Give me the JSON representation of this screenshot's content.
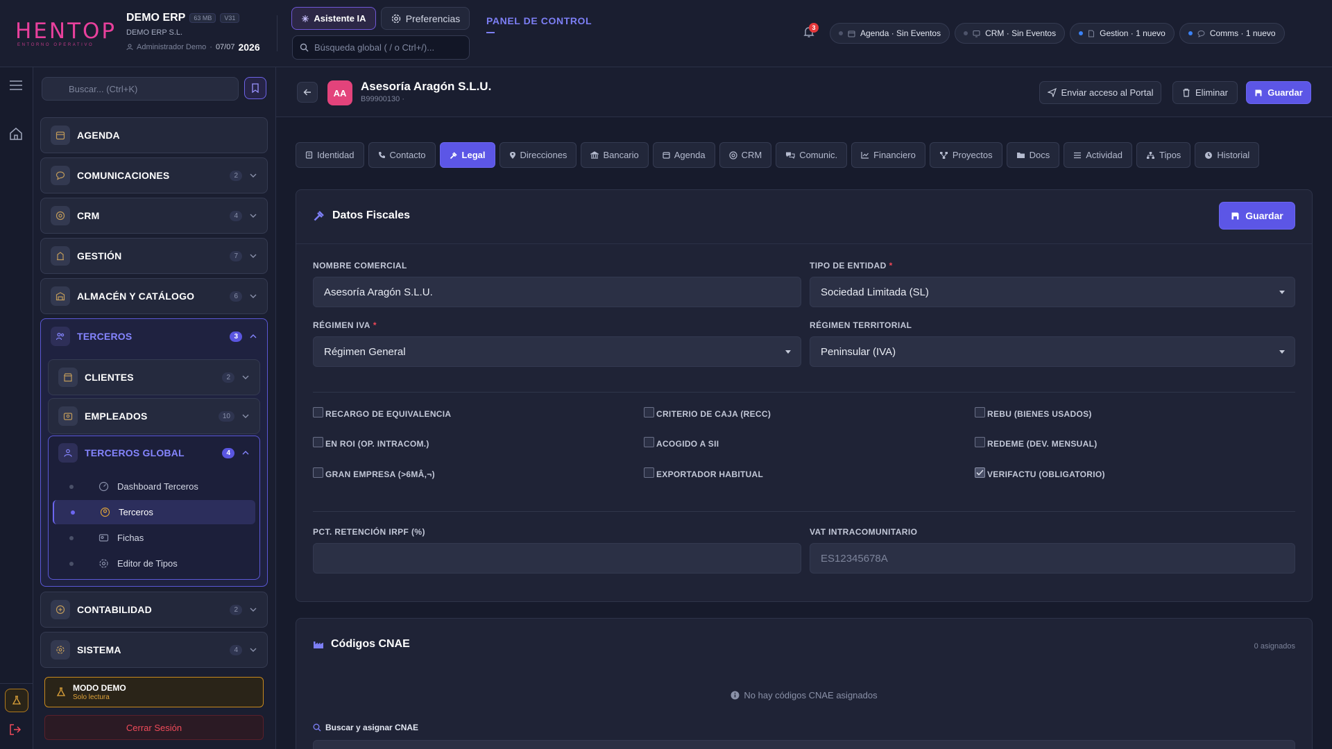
{
  "topbar": {
    "logo_text": "HENTOP",
    "logo_sub": "ENTORNO OPERATIVO",
    "company_name": "DEMO ERP",
    "size_chip": "63 MB",
    "version_chip": "V31",
    "company_sub": "DEMO ERP S.L.",
    "user": "Administrador Demo",
    "date": "07/07",
    "year": "2026",
    "ai_button": "Asistente IA",
    "prefs_button": "Preferencias",
    "search_placeholder": "Búsqueda global ( / o Ctrl+/)...",
    "panel_link": "PANEL DE CONTROL",
    "notif_count": "3",
    "pills": [
      {
        "label": "Agenda · Sin Eventos",
        "dot": "#4d536a"
      },
      {
        "label": "CRM · Sin Eventos",
        "dot": "#4d536a"
      },
      {
        "label": "Gestion · 1 nuevo",
        "dot": "#3b82f6"
      },
      {
        "label": "Comms · 1 nuevo",
        "dot": "#3b82f6"
      }
    ]
  },
  "sidebar": {
    "search_placeholder": "Buscar... (Ctrl+K)",
    "items": [
      {
        "label": "AGENDA",
        "count": ""
      },
      {
        "label": "COMUNICACIONES",
        "count": "2"
      },
      {
        "label": "CRM",
        "count": "4"
      },
      {
        "label": "GESTIÓN",
        "count": "7"
      },
      {
        "label": "ALMACÉN Y CATÁLOGO",
        "count": "6"
      }
    ],
    "group": {
      "label": "TERCEROS",
      "count": "3",
      "sub_items": [
        {
          "label": "CLIENTES",
          "count": "2"
        },
        {
          "label": "EMPLEADOS",
          "count": "10"
        }
      ],
      "subgroup": {
        "label": "TERCEROS GLOBAL",
        "count": "4",
        "leaves": [
          "Dashboard Terceros",
          "Terceros",
          "Fichas",
          "Editor de Tipos"
        ]
      }
    },
    "bottom_items": [
      {
        "label": "CONTABILIDAD",
        "count": "2"
      },
      {
        "label": "SISTEMA",
        "count": "4"
      }
    ],
    "demo_title": "MODO DEMO",
    "demo_sub": "Solo lectura",
    "logout": "Cerrar Sesión"
  },
  "record": {
    "avatar": "AA",
    "title": "Asesoría Aragón S.L.U.",
    "subtitle": "B99900130 ·",
    "send_access": "Enviar acceso al Portal",
    "delete": "Eliminar",
    "save": "Guardar"
  },
  "tabs": [
    {
      "label": "Identidad",
      "icon": "id-card-icon"
    },
    {
      "label": "Contacto",
      "icon": "phone-icon"
    },
    {
      "label": "Legal",
      "icon": "gavel-icon"
    },
    {
      "label": "Direcciones",
      "icon": "map-pin-icon"
    },
    {
      "label": "Bancario",
      "icon": "bank-icon"
    },
    {
      "label": "Agenda",
      "icon": "calendar-icon"
    },
    {
      "label": "CRM",
      "icon": "target-icon"
    },
    {
      "label": "Comunic.",
      "icon": "chat-icon"
    },
    {
      "label": "Financiero",
      "icon": "chart-line-icon"
    },
    {
      "label": "Proyectos",
      "icon": "network-icon"
    },
    {
      "label": "Docs",
      "icon": "folder-icon"
    },
    {
      "label": "Actividad",
      "icon": "list-icon"
    },
    {
      "label": "Tipos",
      "icon": "hierarchy-icon"
    },
    {
      "label": "Historial",
      "icon": "clock-icon"
    }
  ],
  "active_tab": "Legal",
  "fiscal": {
    "title": "Datos Fiscales",
    "save": "Guardar",
    "nombre_label": "NOMBRE COMERCIAL",
    "nombre_value": "Asesoría Aragón S.L.U.",
    "tipo_label": "TIPO DE ENTIDAD",
    "tipo_value": "Sociedad Limitada (SL)",
    "iva_label": "RÉGIMEN IVA",
    "iva_value": "Régimen General",
    "territorial_label": "RÉGIMEN TERRITORIAL",
    "territorial_value": "Peninsular (IVA)",
    "checks": [
      {
        "label": "RECARGO DE EQUIVALENCIA",
        "checked": false
      },
      {
        "label": "CRITERIO DE CAJA (RECC)",
        "checked": false
      },
      {
        "label": "REBU (BIENES USADOS)",
        "checked": false
      },
      {
        "label": "EN ROI (OP. INTRACOM.)",
        "checked": false
      },
      {
        "label": "ACOGIDO A SII",
        "checked": false
      },
      {
        "label": "REDEME (DEV. MENSUAL)",
        "checked": false
      },
      {
        "label": "GRAN EMPRESA (>6MÂ,¬)",
        "checked": false
      },
      {
        "label": "EXPORTADOR HABITUAL",
        "checked": false
      },
      {
        "label": "VERIFACTU (OBLIGATORIO)",
        "checked": true
      }
    ],
    "irpf_label": "PCT. RETENCIÓN IRPF (%)",
    "irpf_value": "",
    "vat_label": "VAT INTRACOMUNITARIO",
    "vat_placeholder": "ES12345678A"
  },
  "cnae": {
    "title": "Códigos CNAE",
    "count": "0 asignados",
    "empty": "No hay códigos CNAE asignados",
    "search_label": "Buscar y asignar CNAE"
  }
}
